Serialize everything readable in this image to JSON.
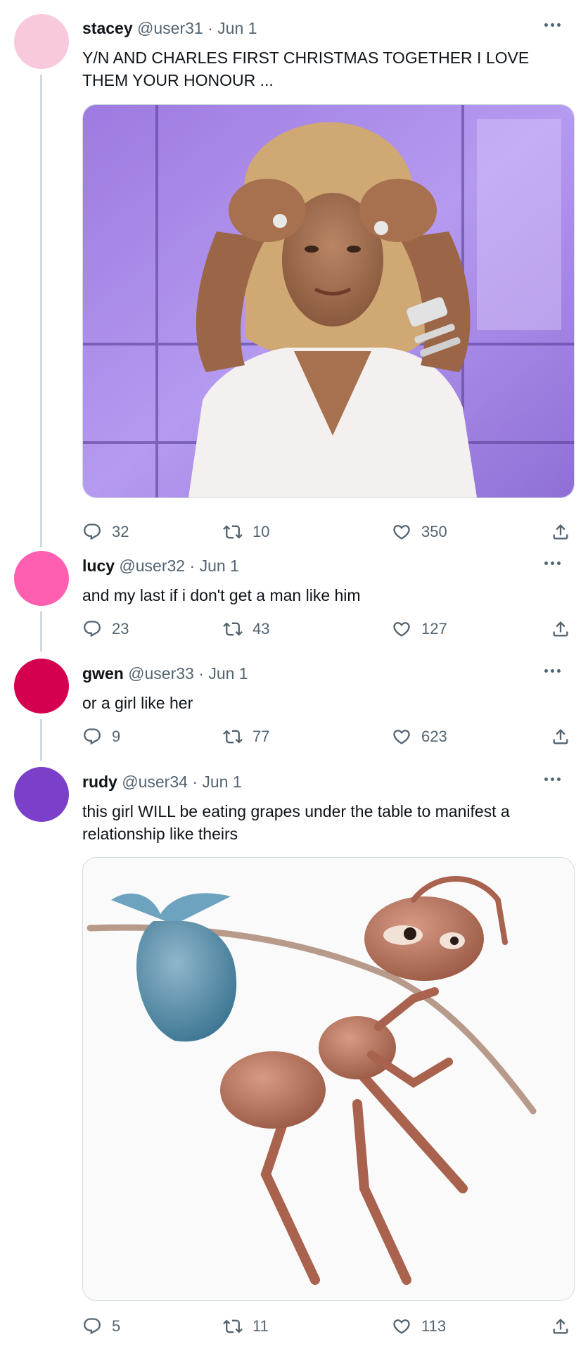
{
  "tweets": [
    {
      "name": "stacey",
      "handle": "@user31",
      "separator": "·",
      "date": "Jun 1",
      "text": "Y/N AND CHARLES FIRST CHRISTMAS TOGETHER I LOVE THEM YOUR HONOUR ...",
      "avatar_color": "#f8c8dc",
      "replies": "32",
      "retweets": "10",
      "likes": "350",
      "image": "photo of a woman in white dress with hands on forehead, purple studio background"
    },
    {
      "name": "lucy",
      "handle": "@user32",
      "separator": "·",
      "date": "Jun 1",
      "text": "and my last if i don't get a man like him",
      "avatar_color": "#ff5fb0",
      "replies": "23",
      "retweets": "43",
      "likes": "127"
    },
    {
      "name": "gwen",
      "handle": "@user33",
      "separator": "·",
      "date": "Jun 1",
      "text": "or a girl like her",
      "avatar_color": "#d4004f",
      "replies": "9",
      "retweets": "77",
      "likes": "623"
    },
    {
      "name": "rudy",
      "handle": "@user34",
      "separator": "·",
      "date": "Jun 1",
      "text": "this girl WILL be eating grapes under the table to manifest a relationship like theirs",
      "avatar_color": "#7b3fc9",
      "replies": "5",
      "retweets": "11",
      "likes": "113",
      "image": "cartoon ant carrying a blue bindle on a stick"
    }
  ],
  "icons": {
    "reply": "reply-icon",
    "retweet": "retweet-icon",
    "like": "heart-icon",
    "share": "share-icon",
    "more": "more-icon"
  },
  "colors": {
    "text": "#0f1419",
    "secondary": "#536471",
    "border": "#cfd9de"
  }
}
